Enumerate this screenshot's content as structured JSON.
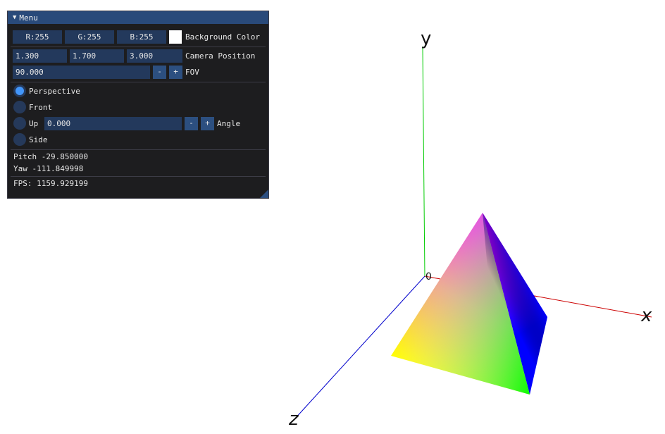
{
  "window": {
    "title": "Menu"
  },
  "background": {
    "r_label": "R:255",
    "g_label": "G:255",
    "b_label": "B:255",
    "label": "Background Color",
    "color": "#ffffff"
  },
  "camera": {
    "x": "1.300",
    "y": "1.700",
    "z": "3.000",
    "label": "Camera Position"
  },
  "fov": {
    "value": "90.000",
    "minus": "-",
    "plus": "+",
    "label": "FOV"
  },
  "views": {
    "perspective": "Perspective",
    "front": "Front",
    "up": "Up",
    "side": "Side",
    "selected": "Perspective"
  },
  "angle": {
    "value": "0.000",
    "minus": "-",
    "plus": "+",
    "label": "Angle"
  },
  "stats": {
    "pitch": "Pitch -29.850000",
    "yaw": "Yaw -111.849998",
    "fps": "FPS: 1159.929199"
  },
  "axes": {
    "x_label": "x",
    "y_label": "y",
    "z_label": "z",
    "origin_label": "0",
    "x_color": "#cc0000",
    "y_color": "#00cc00",
    "z_color": "#0000cc"
  },
  "colors": {
    "title_bar": "#294a7a",
    "panel_bg": "#1d1d1f",
    "field_bg": "#23395c",
    "radio_selected": "#4296fa",
    "pyramid_vertices": [
      "#ff00ff",
      "#0000ff",
      "#00ff00",
      "#ffff00"
    ]
  }
}
